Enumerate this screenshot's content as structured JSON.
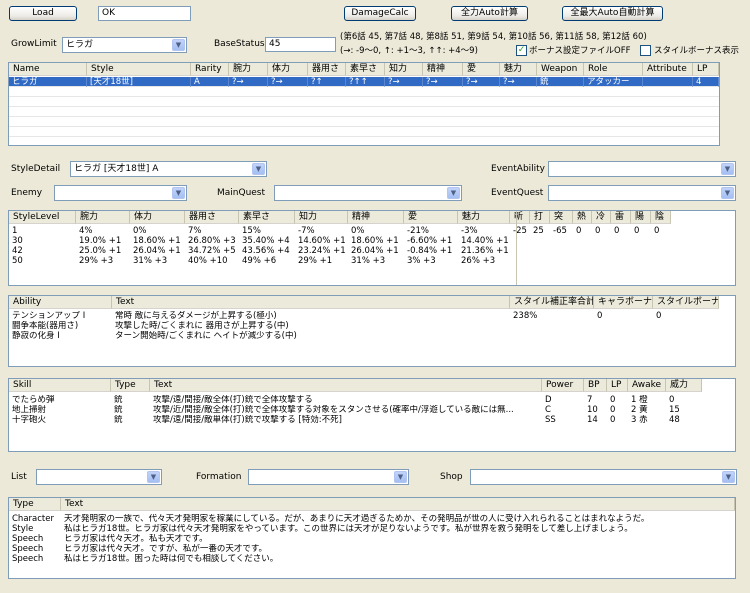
{
  "toolbar": {
    "load_label": "Load",
    "status_value": "OK",
    "damage_calc_label": "DamageCalc",
    "full_auto_label": "全力Auto計算",
    "max_auto_label": "全最大Auto自動計算"
  },
  "params": {
    "grow_limit_label": "GrowLimit",
    "grow_limit_value": "ヒラガ",
    "base_status_label": "BaseStatus",
    "base_status_value": "45",
    "episode_info": "(第6話 45, 第7話 48, 第8話 51, 第9話 54, 第10話 56, 第11話 58, 第12話 60)",
    "arrow_legend": "(→: -9〜0, ↑: +1〜3, ↑↑: +4〜9)",
    "bonus_file_off_label": "ボーナス設定ファイルOFF",
    "bonus_file_off_checked": true,
    "style_bonus_label": "スタイルボーナス表示",
    "style_bonus_checked": false
  },
  "style_table": {
    "columns": [
      "Name",
      "Style",
      "Rarity",
      "腕力",
      "体力",
      "器用さ",
      "素早さ",
      "知力",
      "精神",
      "愛",
      "魅力",
      "Weapon",
      "Role",
      "Attribute",
      "LP"
    ],
    "rows": [
      [
        "ヒラガ",
        "[天才18世]",
        "A",
        "?→",
        "?→",
        "?↑",
        "?↑↑",
        "?→",
        "?→",
        "?→",
        "?→",
        "銃",
        "アタッカー",
        "",
        "4"
      ]
    ]
  },
  "selectors": {
    "style_detail_label": "StyleDetail",
    "style_detail_value": "ヒラガ [天才18世] A",
    "event_ability_label": "EventAbility",
    "event_ability_value": "",
    "enemy_label": "Enemy",
    "enemy_value": "",
    "main_quest_label": "MainQuest",
    "main_quest_value": "",
    "event_quest_label": "EventQuest",
    "event_quest_value": ""
  },
  "level_table": {
    "columns": [
      "StyleLevel",
      "腕力",
      "体力",
      "器用さ",
      "素早さ",
      "知力",
      "精神",
      "愛",
      "魅力"
    ],
    "rows": [
      [
        "1",
        "4%",
        "0%",
        "7%",
        "15%",
        "-7%",
        "0%",
        "-21%",
        "-3%"
      ],
      [
        "30",
        "19.0% +1",
        "18.60% +1",
        "26.80% +3",
        "35.40% +4",
        "14.60% +1",
        "18.60% +1",
        "-6.60% +1",
        "14.40% +1"
      ],
      [
        "42",
        "25.0% +1",
        "26.04% +1",
        "34.72% +5",
        "43.56% +4",
        "23.24% +1",
        "26.04% +1",
        "-0.84% +1",
        "21.36% +1"
      ],
      [
        "50",
        "29% +3",
        "31% +3",
        "40% +10",
        "49% +6",
        "29% +1",
        "31% +3",
        "3% +3",
        "26% +3"
      ]
    ],
    "resist_columns": [
      "斬",
      "打",
      "突",
      "熱",
      "冷",
      "雷",
      "陽",
      "陰"
    ],
    "resist_rows": [
      [
        "-25",
        "25",
        "-65",
        "0",
        "0",
        "0",
        "0",
        "0"
      ],
      [
        "",
        "",
        "",
        "",
        "",
        "",
        "",
        ""
      ],
      [
        "",
        "",
        "",
        "",
        "",
        "",
        "",
        ""
      ],
      [
        "",
        "",
        "",
        "",
        "",
        "",
        "",
        ""
      ]
    ]
  },
  "ability_table": {
    "columns": [
      "Ability",
      "Text",
      "スタイル補正率合計",
      "キャラボーナス",
      "スタイルボーナス"
    ],
    "rows": [
      [
        "テンションアップ I",
        "常時 敵に与えるダメージが上昇する(極小)",
        "238%",
        "0",
        "0"
      ],
      [
        "闘争本能(器用さ)",
        "攻撃した時/ごくまれに 器用さが上昇する(中)",
        "",
        "",
        ""
      ],
      [
        "静寂の化身 I",
        "ターン開始時/ごくまれに ヘイトが減少する(中)",
        "",
        "",
        ""
      ]
    ]
  },
  "skill_table": {
    "columns": [
      "Skill",
      "Type",
      "Text",
      "Power",
      "BP",
      "LP",
      "Awake",
      "威力"
    ],
    "rows": [
      [
        "でたらめ弾",
        "銃",
        "攻撃/遠/間接/敵全体(打)銃で全体攻撃する",
        "D",
        "7",
        "0",
        "1 橙",
        "0"
      ],
      [
        "地上掃射",
        "銃",
        "攻撃/近/間接/敵全体(打)銃で全体攻撃する対象をスタンさせる(確率中/浮遊している敵には無...",
        "C",
        "10",
        "0",
        "2 黄",
        "15"
      ],
      [
        "十字砲火",
        "銃",
        "攻撃/遠/間接/敵単体(打)銃で攻撃する [特効:不死]",
        "SS",
        "14",
        "0",
        "3 赤",
        "48"
      ]
    ]
  },
  "bottom_selectors": {
    "list_label": "List",
    "list_value": "",
    "formation_label": "Formation",
    "formation_value": "",
    "shop_label": "Shop",
    "shop_value": ""
  },
  "text_table": {
    "columns": [
      "Type",
      "Text"
    ],
    "rows": [
      [
        "Character",
        "天才発明家の一族で、代々天才発明家を稼業にしている。だが、あまりに天才過ぎるためか、その発明品が世の人に受け入れられることはまれなようだ。"
      ],
      [
        "Style",
        "私はヒラガ18世。ヒラガ家は代々天才発明家をやっています。この世界には天才が足りないようです。私が世界を救う発明をして差し上げましょう。"
      ],
      [
        "Speech",
        "ヒラガ家は代々天才。私も天才です。"
      ],
      [
        "Speech",
        "ヒラガ家は代々天才。ですが、私が一番の天才です。"
      ],
      [
        "Speech",
        "私はヒラガ18世。困った時は何でも相談してください。"
      ]
    ]
  },
  "colors": {
    "window_bg": "#ece9d8",
    "selection": "#316ac5",
    "border": "#7f9db9"
  }
}
